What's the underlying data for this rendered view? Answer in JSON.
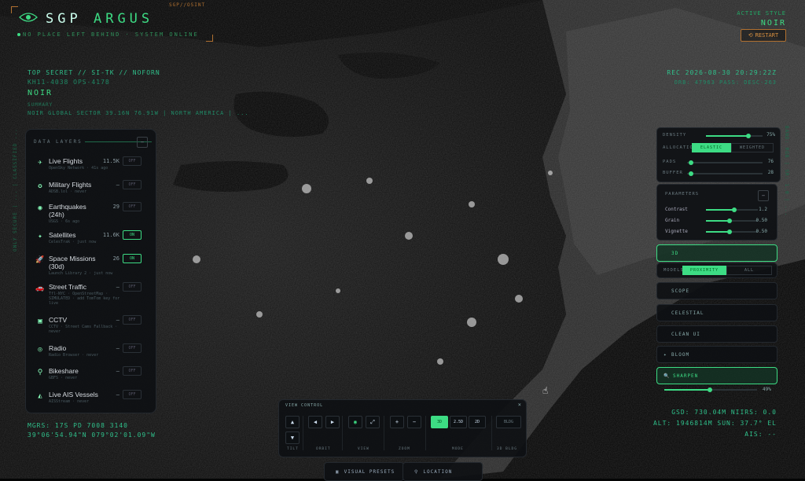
{
  "brand": {
    "title_a": "SGP",
    "title_b": "ARGUS",
    "subtitle": "NO PLACE LEFT BEHIND · SYSTEM ONLINE",
    "top_tag": "SGP//OSINT"
  },
  "style_panel": {
    "label": "ACTIVE STYLE",
    "value": "NOIR",
    "restart": "RESTART"
  },
  "classification": {
    "line1": "TOP SECRET // SI-TK // NOFORN",
    "line2": "KH11-4038 OPS-4178",
    "line3": "NOIR",
    "line4": "SUMMARY",
    "line5": "NOIR GLOBAL SECTOR 39.16N 76.91W | NORTH AMERICA | ..."
  },
  "rec": {
    "line1": "REC 2026-08-30 20:29:22Z",
    "line2": "ORB: 47963 PASS: DESC-263"
  },
  "side_left_text": "ONLY SECURE | ... | CLASSIFIED ...",
  "side_right_text": "BAND: RGB | SR: 1.0 | ...",
  "layers": {
    "header": "DATA LAYERS",
    "collapse": "−",
    "items": [
      {
        "icon": "✈",
        "name": "Live Flights",
        "sub": "OpenSky Network · 41s ago",
        "count": "11.5K",
        "toggle": "OFF",
        "on": false
      },
      {
        "icon": "✪",
        "name": "Military Flights",
        "sub": "ADSB.lol · never",
        "count": "—",
        "toggle": "OFF",
        "on": false
      },
      {
        "icon": "◉",
        "name": "Earthquakes (24h)",
        "sub": "USGS · 6s ago",
        "count": "29",
        "toggle": "OFF",
        "on": false
      },
      {
        "icon": "✦",
        "name": "Satellites",
        "sub": "CelesTrak · just now",
        "count": "11.6K",
        "toggle": "ON",
        "on": true
      },
      {
        "icon": "🚀",
        "name": "Space Missions (30d)",
        "sub": "Launch Library 2 · just now",
        "count": "26",
        "toggle": "ON",
        "on": true
      },
      {
        "icon": "🚗",
        "name": "Street Traffic",
        "sub": "Tfl-NYC · OpenStreetMap · SIMULATED · add TomTom key for live",
        "count": "—",
        "toggle": "OFF",
        "on": false
      },
      {
        "icon": "▣",
        "name": "CCTV",
        "sub": "CCTV · Street Cams Fallback · never",
        "count": "—",
        "toggle": "OFF",
        "on": false
      },
      {
        "icon": "◎",
        "name": "Radio",
        "sub": "Radio Browser · never",
        "count": "—",
        "toggle": "OFF",
        "on": false
      },
      {
        "icon": "⚲",
        "name": "Bikeshare",
        "sub": "GBFS · never",
        "count": "—",
        "toggle": "OFF",
        "on": false
      },
      {
        "icon": "◭",
        "name": "Live AIS Vessels",
        "sub": "AISStream · never",
        "count": "—",
        "toggle": "OFF",
        "on": false
      }
    ]
  },
  "right_panel": {
    "density_label": "DENSITY",
    "density_value": "75%",
    "density": 0.75,
    "allocation_label": "ALLOCATION",
    "alloc_a": "ELASTIC",
    "alloc_b": "WEIGHTED",
    "pads_label": "PADS",
    "pads_value": "76",
    "pads": 0.05,
    "buffer_label": "BUFFER",
    "buffer_value": "28",
    "buffer": 0.05,
    "params_label": "PARAMETERS",
    "params": [
      {
        "name": "Contrast",
        "value": "1.2",
        "level": 0.55
      },
      {
        "name": "Grain",
        "value": "0.50",
        "level": 0.45
      },
      {
        "name": "Vignette",
        "value": "0.50",
        "level": 0.45
      }
    ],
    "btn_3d": "3D",
    "models_label": "MODELS",
    "models_a": "PROXIMITY",
    "models_b": "ALL",
    "scope": "SCOPE",
    "celestial": "CELESTIAL",
    "clean_ui": "CLEAN UI",
    "bloom": "BLOOM",
    "sharpen": "SHARPEN",
    "sharpen_value": "49%",
    "sharpen_level": 0.49
  },
  "gsd": {
    "line1": "GSD: 730.04M NIIRS: 0.0",
    "line2": "ALT: 1946814M SUN: 37.7° EL",
    "line3": "AIS: --"
  },
  "mgrs": {
    "line1": "MGRS: 17S PD 7008 3140",
    "line2": "39°06'54.94\"N 079°02'01.09\"W"
  },
  "video": {
    "title": "VIEW CONTROL",
    "close": "×",
    "tilt_label": "TILT",
    "orbit_label": "ORBIT",
    "view_label": "VIEW",
    "zoom_label": "ZOOM",
    "mode_label": "MODE",
    "bldg_label": "3D BLDG",
    "mode_a": "3D",
    "mode_b": "2.5D",
    "mode_c": "2D",
    "bldg": "BLDG"
  },
  "tabs": {
    "presets": "VISUAL PRESETS",
    "location": "LOCATION"
  }
}
